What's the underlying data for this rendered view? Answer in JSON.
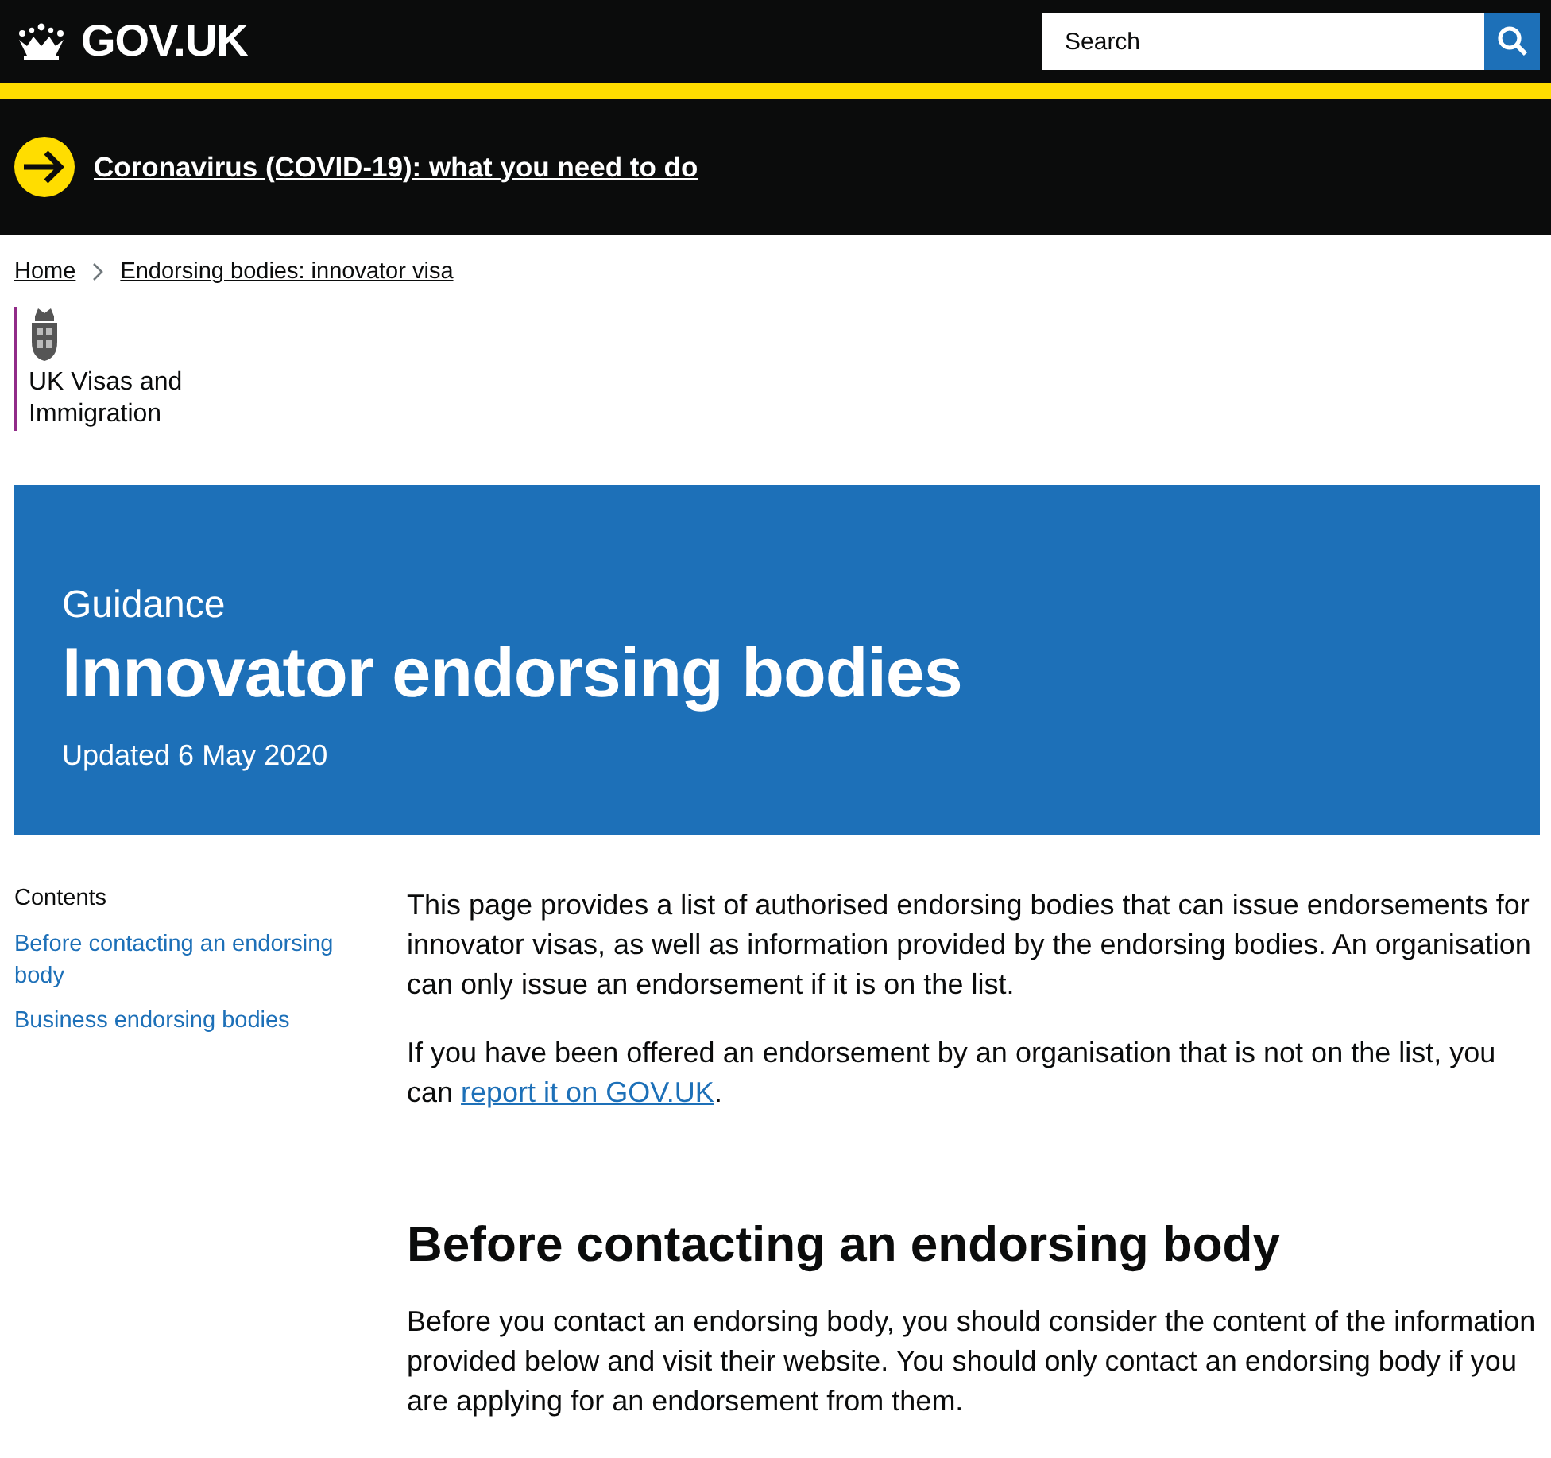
{
  "header": {
    "logo": "GOV.UK",
    "search": {
      "placeholder": "Search"
    }
  },
  "banner": {
    "link": "Coronavirus (COVID-19): what you need to do"
  },
  "breadcrumbs": [
    {
      "label": "Home"
    },
    {
      "label": "Endorsing bodies: innovator visa"
    }
  ],
  "organisation": {
    "name": "UK Visas and Immigration"
  },
  "hero": {
    "type": "Guidance",
    "title": "Innovator endorsing bodies",
    "updated": "Updated 6 May 2020"
  },
  "contents": {
    "title": "Contents",
    "items": [
      {
        "label": "Before contacting an endorsing body"
      },
      {
        "label": "Business endorsing bodies"
      }
    ]
  },
  "body": [
    {
      "kind": "paragraph",
      "parts": [
        {
          "kind": "text",
          "text": "This page provides a list of authorised endorsing bodies that can issue endorsements for innovator visas, as well as information provided by the endorsing bodies. An organisation can only issue an endorsement if it is on the list."
        }
      ]
    },
    {
      "kind": "paragraph",
      "parts": [
        {
          "kind": "text",
          "text": "If you have been offered an endorsement by an organisation that is not on the list, you can "
        },
        {
          "kind": "link",
          "text": "report it on GOV.UK"
        },
        {
          "kind": "text",
          "text": "."
        }
      ]
    },
    {
      "kind": "heading",
      "text": "Before contacting an endorsing body"
    },
    {
      "kind": "paragraph",
      "parts": [
        {
          "kind": "text",
          "text": "Before you contact an endorsing body, you should consider the content of the information provided below and visit their website. You should only contact an endorsing body if you are applying for an endorsement from them."
        }
      ]
    }
  ]
}
